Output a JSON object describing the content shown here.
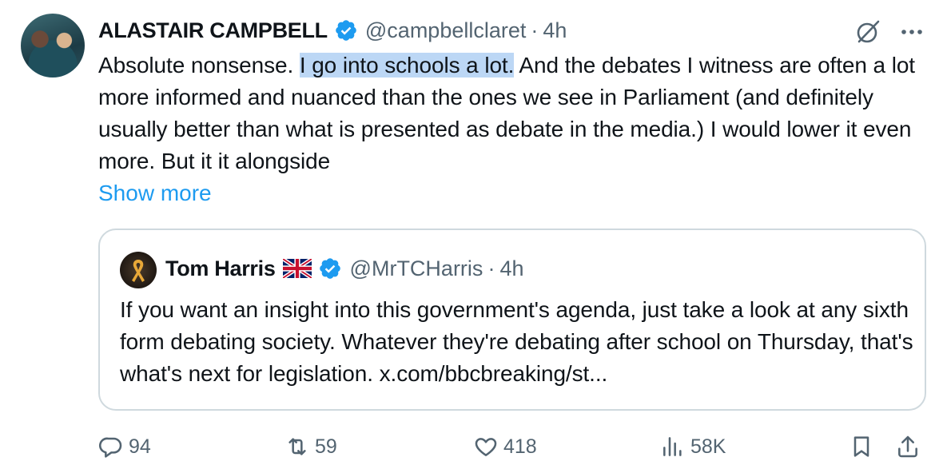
{
  "tweet": {
    "author_name": "ALASTAIR CAMPBELL",
    "handle": "@campbellclaret",
    "separator": "·",
    "time": "4h",
    "text_before": "Absolute nonsense. ",
    "text_highlight": "I go into schools a lot.",
    "text_after": " And the debates I witness are often a lot more informed and nuanced than the ones we see in Parliament (and definitely usually better than what is presented as debate in the media.) I would lower it even more. But it it alongside",
    "show_more": "Show more"
  },
  "quoted_tweet": {
    "author_name": "Tom Harris",
    "handle": "@MrTCHarris",
    "separator": "·",
    "time": "4h",
    "text": "If you want an insight into this government's agenda, just take a look at any sixth form debating society. Whatever they're debating after school on Thursday, that's what's next for legislation. x.com/bbcbreaking/st..."
  },
  "actions": {
    "replies": "94",
    "reposts": "59",
    "likes": "418",
    "views": "58K"
  },
  "icons": {
    "verified": "verified-badge-icon",
    "grok": "grok-icon",
    "more": "more-icon",
    "flag": "uk-flag-icon",
    "reply": "reply-icon",
    "repost": "repost-icon",
    "like": "heart-icon",
    "views": "views-icon",
    "bookmark": "bookmark-icon",
    "share": "share-icon"
  },
  "colors": {
    "text": "#0f1419",
    "secondary": "#536471",
    "link": "#1d9bf0",
    "highlight": "#bcd7f5",
    "border": "#cfd9de"
  }
}
